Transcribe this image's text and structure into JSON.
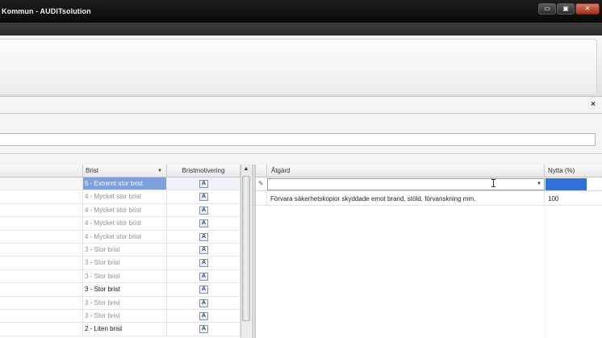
{
  "window": {
    "title": "Kommun - AUDITsolution",
    "buttons": {
      "minimize": "▭",
      "restore": "▣",
      "close": "✕"
    }
  },
  "document": {
    "close_label": "×"
  },
  "left_grid": {
    "columns": {
      "brist": "Brist",
      "bristmotivering": "Bristmotivering"
    },
    "filter_glyph": "▼",
    "motivation_icon_glyph": "A",
    "rows": [
      {
        "brist": "5 - Extremt stor brist",
        "selected": true,
        "emphasis": false
      },
      {
        "brist": "4 - Mycket stor brist",
        "selected": false,
        "emphasis": false
      },
      {
        "brist": "4 - Mycket stor brist",
        "selected": false,
        "emphasis": false
      },
      {
        "brist": "4 - Mycket stor brist",
        "selected": false,
        "emphasis": false
      },
      {
        "brist": "4 - Mycket stor brist",
        "selected": false,
        "emphasis": false
      },
      {
        "brist": "3 - Stor brist",
        "selected": false,
        "emphasis": false
      },
      {
        "brist": "3 - Stor brist",
        "selected": false,
        "emphasis": false
      },
      {
        "brist": "3 - Stor brist",
        "selected": false,
        "emphasis": false
      },
      {
        "brist": "3 - Stor brist",
        "selected": false,
        "emphasis": true
      },
      {
        "brist": "3 - Stor brist",
        "selected": false,
        "emphasis": false
      },
      {
        "brist": "3 - Stor brist",
        "selected": false,
        "emphasis": false
      },
      {
        "brist": "2 - Liten brist",
        "selected": false,
        "emphasis": true
      }
    ]
  },
  "right_grid": {
    "columns": {
      "atgard": "Åtgärd",
      "nytta": "Nytta (%)"
    },
    "new_row": {
      "pencil_glyph": "✎",
      "atgard_value": "",
      "nytta_value": ""
    },
    "rows": [
      {
        "atgard": "Förvara säkerhetskopior skyddade emot brand, stöld, förvanskning mm.",
        "nytta": "100"
      }
    ]
  },
  "colors": {
    "selection": "#7f9fdd",
    "edit_cell": "#2f73d9",
    "titlebar": "#0f0f0f"
  }
}
